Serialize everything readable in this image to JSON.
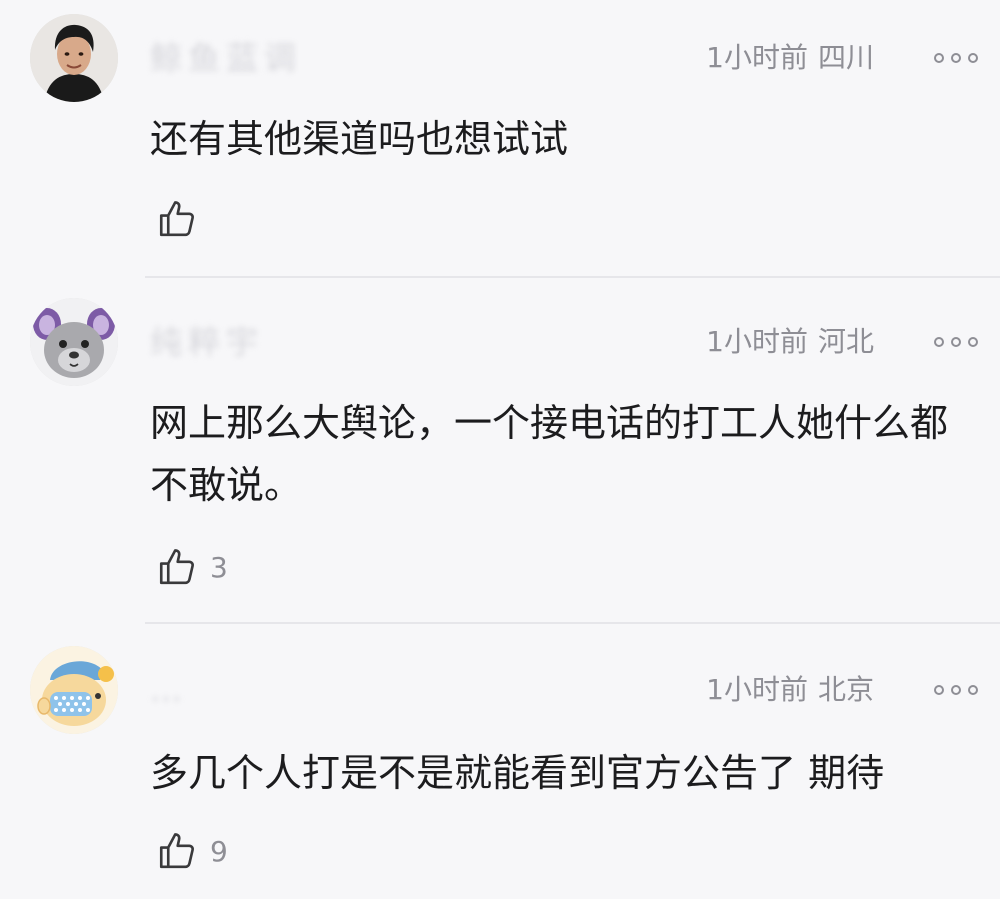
{
  "comments": [
    {
      "username": "鲸鱼蓝调",
      "time": "1小时前",
      "location": "四川",
      "text": "还有其他渠道吗也想试试",
      "likes": ""
    },
    {
      "username": "纯粹宇",
      "time": "1小时前",
      "location": "河北",
      "text": "网上那么大舆论，一个接电话的打工人她什么都不敢说。",
      "likes": "3"
    },
    {
      "username": "…",
      "time": "1小时前",
      "location": "北京",
      "text": "多几个人打是不是就能看到官方公告了 期待",
      "likes": "9"
    }
  ],
  "icons": {
    "like": "thumbs-up-icon",
    "more": "more-icon"
  }
}
